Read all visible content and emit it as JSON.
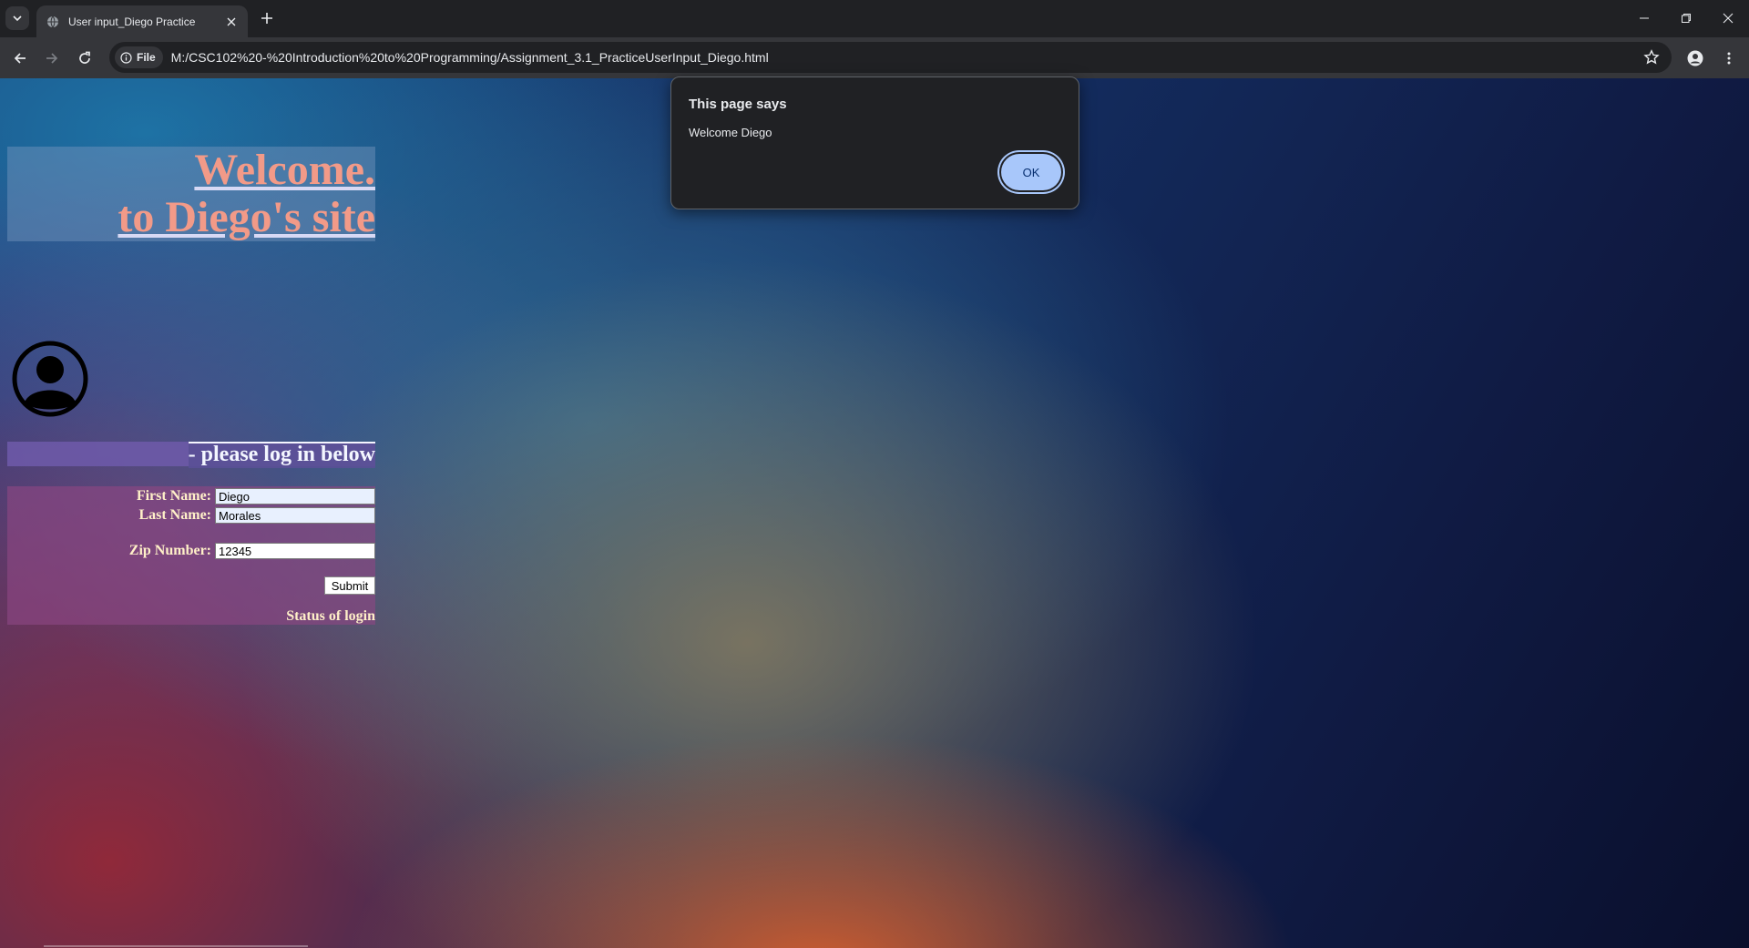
{
  "browser": {
    "tab_title": "User input_Diego Practice",
    "security_chip": "File",
    "url": "M:/CSC102%20-%20Introduction%20to%20Programming/Assignment_3.1_PracticeUserInput_Diego.html"
  },
  "page": {
    "welcome_line1": "Welcome.",
    "welcome_line2": "to Diego's site",
    "login_heading": "- please log in below",
    "form": {
      "first_name_label": "First Name:",
      "first_name_value": "Diego",
      "last_name_label": "Last Name:",
      "last_name_value": "Morales",
      "zip_label": "Zip Number:",
      "zip_value": "12345",
      "submit_label": "Submit"
    },
    "status_label": "Status of login"
  },
  "dialog": {
    "title": "This page says",
    "message": "Welcome Diego",
    "ok_label": "OK"
  },
  "colors": {
    "heading": "#f29a88",
    "label": "#fff0c8",
    "dialog_button": "#a8c7fa"
  }
}
